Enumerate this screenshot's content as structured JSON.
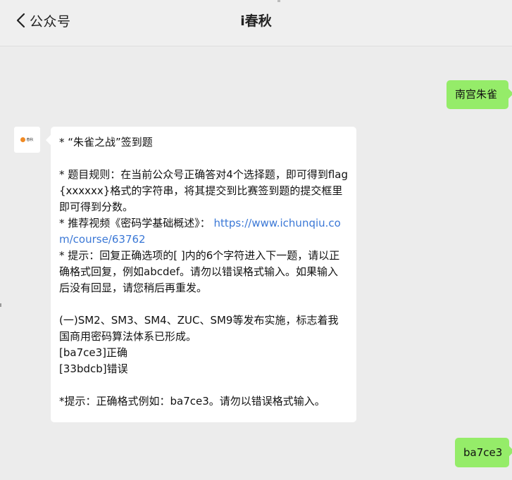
{
  "header": {
    "back_label": "公众号",
    "title": "i春秋"
  },
  "avatar": {
    "label": "春秋",
    "accent": "#f08a24"
  },
  "messages": {
    "sent_1": "南宫朱雀",
    "received": {
      "line1": "* “朱雀之战”签到题",
      "rules": "* 题目规则：在当前公众号正确答对4个选择题，即可得到flag{xxxxxx}格式的字符串，将其提交到比赛签到题的提交框里即可得到分数。",
      "video_prefix": "* 推荐视频《密码学基础概述》： ",
      "video_link": "https://www.ichunqiu.com/course/63762",
      "hint": "* 提示：回复正确选项的[ ]内的6个字符进入下一题，请以正确格式回复，例如abcdef。请勿以错误格式输入。如果输入后没有回显，请您稍后再重发。",
      "question": "(一)SM2、SM3、SM4、ZUC、SM9等发布实施，标志着我国商用密码算法体系已形成。",
      "option_a": "[ba7ce3]正确",
      "option_b": "[33bdcb]错误",
      "final_hint": "*提示：正确格式例如：ba7ce3。请勿以错误格式输入。"
    },
    "sent_2": "ba7ce3"
  },
  "colors": {
    "background": "#ececec",
    "sent_bubble": "#95ec69",
    "received_bubble": "#ffffff",
    "link": "#3b78d6"
  }
}
